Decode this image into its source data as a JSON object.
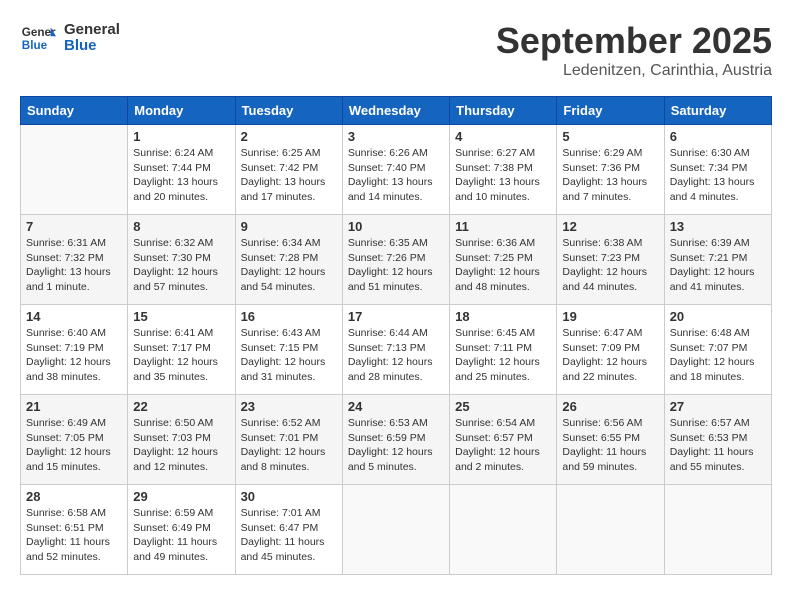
{
  "header": {
    "logo_line1": "General",
    "logo_line2": "Blue",
    "month": "September 2025",
    "location": "Ledenitzen, Carinthia, Austria"
  },
  "days_of_week": [
    "Sunday",
    "Monday",
    "Tuesday",
    "Wednesday",
    "Thursday",
    "Friday",
    "Saturday"
  ],
  "weeks": [
    [
      {
        "day": "",
        "info": ""
      },
      {
        "day": "1",
        "info": "Sunrise: 6:24 AM\nSunset: 7:44 PM\nDaylight: 13 hours\nand 20 minutes."
      },
      {
        "day": "2",
        "info": "Sunrise: 6:25 AM\nSunset: 7:42 PM\nDaylight: 13 hours\nand 17 minutes."
      },
      {
        "day": "3",
        "info": "Sunrise: 6:26 AM\nSunset: 7:40 PM\nDaylight: 13 hours\nand 14 minutes."
      },
      {
        "day": "4",
        "info": "Sunrise: 6:27 AM\nSunset: 7:38 PM\nDaylight: 13 hours\nand 10 minutes."
      },
      {
        "day": "5",
        "info": "Sunrise: 6:29 AM\nSunset: 7:36 PM\nDaylight: 13 hours\nand 7 minutes."
      },
      {
        "day": "6",
        "info": "Sunrise: 6:30 AM\nSunset: 7:34 PM\nDaylight: 13 hours\nand 4 minutes."
      }
    ],
    [
      {
        "day": "7",
        "info": "Sunrise: 6:31 AM\nSunset: 7:32 PM\nDaylight: 13 hours\nand 1 minute."
      },
      {
        "day": "8",
        "info": "Sunrise: 6:32 AM\nSunset: 7:30 PM\nDaylight: 12 hours\nand 57 minutes."
      },
      {
        "day": "9",
        "info": "Sunrise: 6:34 AM\nSunset: 7:28 PM\nDaylight: 12 hours\nand 54 minutes."
      },
      {
        "day": "10",
        "info": "Sunrise: 6:35 AM\nSunset: 7:26 PM\nDaylight: 12 hours\nand 51 minutes."
      },
      {
        "day": "11",
        "info": "Sunrise: 6:36 AM\nSunset: 7:25 PM\nDaylight: 12 hours\nand 48 minutes."
      },
      {
        "day": "12",
        "info": "Sunrise: 6:38 AM\nSunset: 7:23 PM\nDaylight: 12 hours\nand 44 minutes."
      },
      {
        "day": "13",
        "info": "Sunrise: 6:39 AM\nSunset: 7:21 PM\nDaylight: 12 hours\nand 41 minutes."
      }
    ],
    [
      {
        "day": "14",
        "info": "Sunrise: 6:40 AM\nSunset: 7:19 PM\nDaylight: 12 hours\nand 38 minutes."
      },
      {
        "day": "15",
        "info": "Sunrise: 6:41 AM\nSunset: 7:17 PM\nDaylight: 12 hours\nand 35 minutes."
      },
      {
        "day": "16",
        "info": "Sunrise: 6:43 AM\nSunset: 7:15 PM\nDaylight: 12 hours\nand 31 minutes."
      },
      {
        "day": "17",
        "info": "Sunrise: 6:44 AM\nSunset: 7:13 PM\nDaylight: 12 hours\nand 28 minutes."
      },
      {
        "day": "18",
        "info": "Sunrise: 6:45 AM\nSunset: 7:11 PM\nDaylight: 12 hours\nand 25 minutes."
      },
      {
        "day": "19",
        "info": "Sunrise: 6:47 AM\nSunset: 7:09 PM\nDaylight: 12 hours\nand 22 minutes."
      },
      {
        "day": "20",
        "info": "Sunrise: 6:48 AM\nSunset: 7:07 PM\nDaylight: 12 hours\nand 18 minutes."
      }
    ],
    [
      {
        "day": "21",
        "info": "Sunrise: 6:49 AM\nSunset: 7:05 PM\nDaylight: 12 hours\nand 15 minutes."
      },
      {
        "day": "22",
        "info": "Sunrise: 6:50 AM\nSunset: 7:03 PM\nDaylight: 12 hours\nand 12 minutes."
      },
      {
        "day": "23",
        "info": "Sunrise: 6:52 AM\nSunset: 7:01 PM\nDaylight: 12 hours\nand 8 minutes."
      },
      {
        "day": "24",
        "info": "Sunrise: 6:53 AM\nSunset: 6:59 PM\nDaylight: 12 hours\nand 5 minutes."
      },
      {
        "day": "25",
        "info": "Sunrise: 6:54 AM\nSunset: 6:57 PM\nDaylight: 12 hours\nand 2 minutes."
      },
      {
        "day": "26",
        "info": "Sunrise: 6:56 AM\nSunset: 6:55 PM\nDaylight: 11 hours\nand 59 minutes."
      },
      {
        "day": "27",
        "info": "Sunrise: 6:57 AM\nSunset: 6:53 PM\nDaylight: 11 hours\nand 55 minutes."
      }
    ],
    [
      {
        "day": "28",
        "info": "Sunrise: 6:58 AM\nSunset: 6:51 PM\nDaylight: 11 hours\nand 52 minutes."
      },
      {
        "day": "29",
        "info": "Sunrise: 6:59 AM\nSunset: 6:49 PM\nDaylight: 11 hours\nand 49 minutes."
      },
      {
        "day": "30",
        "info": "Sunrise: 7:01 AM\nSunset: 6:47 PM\nDaylight: 11 hours\nand 45 minutes."
      },
      {
        "day": "",
        "info": ""
      },
      {
        "day": "",
        "info": ""
      },
      {
        "day": "",
        "info": ""
      },
      {
        "day": "",
        "info": ""
      }
    ]
  ]
}
